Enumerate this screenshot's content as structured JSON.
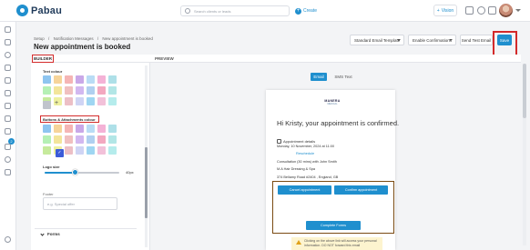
{
  "app": {
    "name": "Pabau"
  },
  "topbar": {
    "search_placeholder": "Search clients or leads",
    "create_label": "Create",
    "vision_label": "Vision"
  },
  "breadcrumbs": [
    "Setup",
    "/",
    "Notification Messages",
    "/",
    "New appointment is booked"
  ],
  "page_title": "New appointment is booked",
  "toolbar": {
    "template_select": "Standard Email Template",
    "confirmations_select": "Enable Confirmations",
    "send_test_label": "Send Test Email",
    "save_label": "Save"
  },
  "sections": {
    "builder_label": "BUILDER",
    "preview_label": "PREVIEW"
  },
  "builder": {
    "text_colour_label": "Text colour",
    "buttons_colour_label": "Buttons & Attachments colour",
    "add_colour_symbol": "+",
    "logo_size_label": "Logo size",
    "logo_size_value": "40px",
    "logo_size_fraction": 0.4,
    "footer_label": "Footer",
    "footer_placeholder": "e.g. Special offer",
    "forms_label": "Forms",
    "swatch_colors": [
      "#8ec5f0",
      "#f6d49a",
      "#f5b5b5",
      "#c9a8e8",
      "#b9dcf5",
      "#f4b2d6",
      "#aee0e8",
      "#b5f0b5",
      "#f3e59b",
      "#f0c0c0",
      "#d2b8f0",
      "#b0d0f0",
      "#f3a8c0",
      "#b2e6e6",
      "#c6ea9c",
      "#eef0a0",
      "#ecbfc6",
      "#cfd4f4",
      "#9fd6f2",
      "#f2c1d9",
      "#b5ecec",
      "#c0c4cc"
    ],
    "button_swatch_colors": [
      "#8ec5f0",
      "#f6d49a",
      "#f5b5b5",
      "#c9a8e8",
      "#b9dcf5",
      "#f4b2d6",
      "#aee0e8",
      "#b5f0b5",
      "#f3e59b",
      "#f0c0c0",
      "#d2b8f0",
      "#b0d0f0",
      "#f3a8c0",
      "#b2e6e6",
      "#c6ea9c",
      "#eef0a0",
      "#ecbfc6",
      "#cfd4f4",
      "#9fd6f2",
      "#f2c1d9",
      "#b5ecec"
    ],
    "selected_button_color": "#3c5bd8"
  },
  "preview": {
    "tabs": [
      "Email",
      "SMS Text"
    ],
    "active_tab": "Email",
    "brand_name": "MANERA",
    "brand_sub": "MEDICAL",
    "greeting": "Hi Kristy, your appointment is confirmed.",
    "details_heading": "Appointment details",
    "appointment_date": "Monday, 10 November, 2024 at 11:00",
    "reschedule_label": "Reschedule",
    "consultation_line": "Consultation (30 mins) with John Smith",
    "business_name": "M.A Hair Dressing & Spa",
    "address_line": "374 Bellamy Road #2404 , England, GB",
    "cancel_label": "Cancel appointment",
    "confirm_label": "Confirm appointment",
    "complete_forms_label": "Complete Forms",
    "notice_text": "Clicking on the above link will access your personal information. DO NOT forward this email"
  },
  "colors": {
    "accent": "#1f8fce",
    "highlight": "#d32a2a"
  }
}
